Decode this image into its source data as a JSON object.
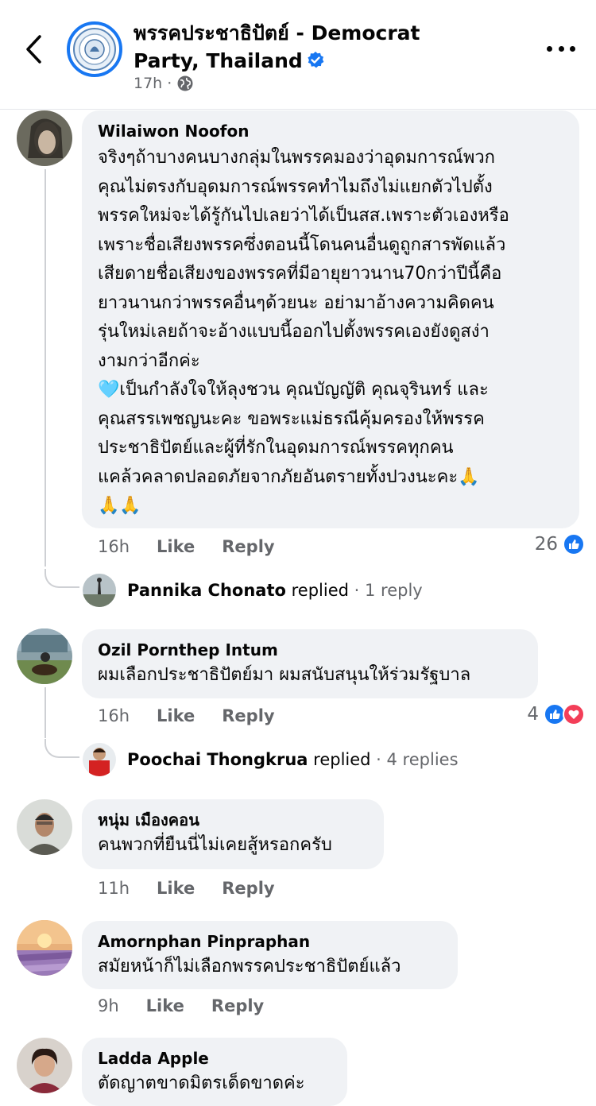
{
  "header": {
    "page_name": "พรรคประชาธิปัตย์ - Democrat Party, Thailand",
    "post_time": "17h",
    "meta_separator": "·"
  },
  "colors": {
    "accent": "#1877f2",
    "bubble": "#f0f2f5",
    "secondary_text": "#65676b",
    "love": "#f33e58"
  },
  "comments": [
    {
      "author": "Wilaiwon Noofon",
      "text": "จริงๆถ้าบางคนบางกลุ่มในพรรคมองว่าอุดมการณ์พวก\nคุณไม่ตรงกับอุดมการณ์พรรคทำไมถึงไม่แยกตัวไปตั้ง\nพรรคใหม่จะได้รู้กันไปเลยว่าได้เป็นสส.เพราะตัวเองหรือ\nเพราะชื่อเสียงพรรคซึ่งตอนนี้โดนคนอื่นดูถูกสารพัดแล้ว\nเสียดายชื่อเสียงของพรรคที่มีอายุยาวนาน70กว่าปีนี้คือ\nยาวนานกว่าพรรคอื่นๆด้วยนะ อย่ามาอ้างความคิดคน\nรุ่นใหม่เลยถ้าจะอ้างแบบนี้ออกไปตั้งพรรคเองยังดูสง่า\nงามกว่าอีกค่ะ\n🩵เป็นกำลังใจให้ลุงชวน คุณบัญญัติ คุณจุรินทร์ และ\nคุณสรรเพชญนะคะ ขอพระแม่ธรณีคุ้มครองให้พรรค\nประชาธิปัตย์และผู้ที่รักในอุดมการณ์พรรคทุกคน\nแคล้วคลาดปลอดภัยจากภัยอันตรายทั้งปวงนะคะ🙏\n🙏🙏",
      "time": "16h",
      "like": "Like",
      "reply": "Reply",
      "reaction_count": "26",
      "reply_summary": {
        "name": "Pannika Chonato",
        "replied": "replied",
        "count": "· 1 reply"
      }
    },
    {
      "author": "Ozil Pornthep Intum",
      "text": "ผมเลือกประชาธิปัตย์มา ผมสนับสนุนให้ร่วมรัฐบาล",
      "time": "16h",
      "like": "Like",
      "reply": "Reply",
      "reaction_count": "4",
      "reply_summary": {
        "name": "Poochai Thongkrua",
        "replied": "replied",
        "count": "· 4 replies"
      }
    },
    {
      "author": "หนุ่ม เมืองคอน",
      "text": "คนพวกที่ยืนนี่ไม่เคยสู้หรอกครับ",
      "time": "11h",
      "like": "Like",
      "reply": "Reply"
    },
    {
      "author": "Amornphan Pinpraphan",
      "text": "สมัยหน้าก็ไม่เลือกพรรคประชาธิปัตย์แล้ว",
      "time": "9h",
      "like": "Like",
      "reply": "Reply"
    },
    {
      "author": "Ladda Apple",
      "text": "ตัดญาตขาดมิตรเด็ดขาดค่ะ"
    }
  ]
}
